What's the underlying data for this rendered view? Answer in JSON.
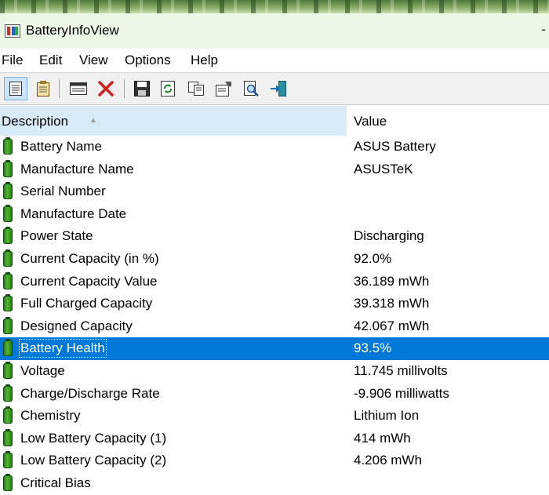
{
  "window": {
    "title": "BatteryInfoView",
    "minimize_glyph": "-"
  },
  "menu": {
    "items": [
      "File",
      "Edit",
      "View",
      "Options",
      "Help"
    ]
  },
  "toolbar": {
    "buttons": [
      "properties-view-icon",
      "report-view-icon",
      "summary-window-icon",
      "delete-icon",
      "save-icon",
      "refresh-icon",
      "copy-icon",
      "properties-icon",
      "find-icon",
      "exit-icon"
    ]
  },
  "list": {
    "headers": {
      "description": "Description",
      "value": "Value"
    },
    "sort_indicator": "▲",
    "rows": [
      {
        "description": "Battery Name",
        "value": "ASUS Battery"
      },
      {
        "description": "Manufacture Name",
        "value": "ASUSTeK"
      },
      {
        "description": "Serial Number",
        "value": ""
      },
      {
        "description": "Manufacture Date",
        "value": ""
      },
      {
        "description": "Power State",
        "value": "Discharging"
      },
      {
        "description": "Current Capacity (in %)",
        "value": "92.0%"
      },
      {
        "description": "Current Capacity Value",
        "value": "36.189 mWh"
      },
      {
        "description": "Full Charged Capacity",
        "value": "39.318 mWh"
      },
      {
        "description": "Designed Capacity",
        "value": "42.067 mWh"
      },
      {
        "description": "Battery Health",
        "value": "93.5%",
        "selected": true
      },
      {
        "description": "Voltage",
        "value": "11.745 millivolts"
      },
      {
        "description": "Charge/Discharge Rate",
        "value": "-9.906 milliwatts"
      },
      {
        "description": "Chemistry",
        "value": "Lithium Ion"
      },
      {
        "description": "Low Battery Capacity (1)",
        "value": "414 mWh"
      },
      {
        "description": "Low Battery Capacity (2)",
        "value": "4.206 mWh"
      },
      {
        "description": "Critical Bias",
        "value": ""
      }
    ]
  },
  "colors": {
    "selection": "#0078d7",
    "header_sorted": "#d9eaf7",
    "titlebar": "#ecf7e6"
  }
}
